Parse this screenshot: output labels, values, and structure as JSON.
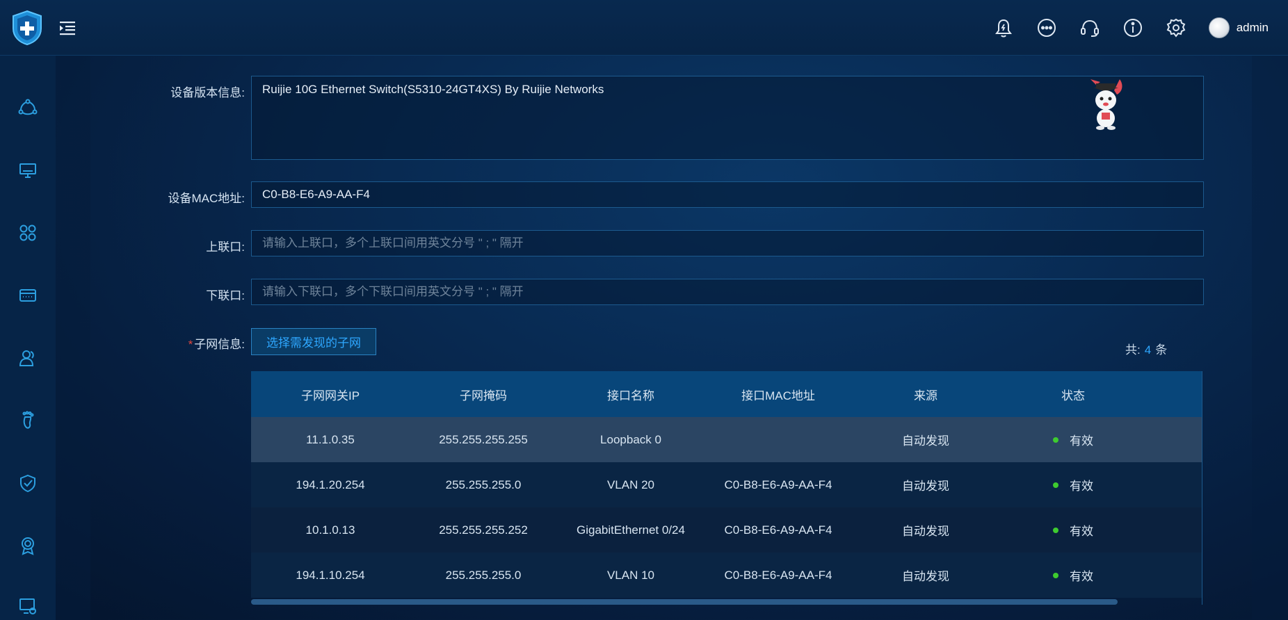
{
  "header": {
    "username": "admin",
    "icons": [
      "bell-icon",
      "more-icon",
      "headset-icon",
      "info-icon",
      "gear-icon"
    ]
  },
  "sidebar": {
    "items": [
      "topology-icon",
      "monitor-icon",
      "apps-icon",
      "device-icon",
      "user-icon",
      "footprint-icon",
      "shield-check-icon",
      "award-icon",
      "screen-settings-icon"
    ]
  },
  "form": {
    "version_label": "设备版本信息:",
    "version_value": "Ruijie 10G Ethernet Switch(S5310-24GT4XS) By Ruijie Networks",
    "mac_label": "设备MAC地址:",
    "mac_value": "C0-B8-E6-A9-AA-F4",
    "uplink_label": "上联口:",
    "uplink_placeholder": "请输入上联口，多个上联口间用英文分号 \" ; \" 隔开",
    "downlink_label": "下联口:",
    "downlink_placeholder": "请输入下联口，多个下联口间用英文分号 \" ; \" 隔开",
    "subnet_required": "*",
    "subnet_label": "子网信息:",
    "select_button": "选择需发现的子网"
  },
  "total": {
    "prefix": "共:",
    "count": "4",
    "suffix": "条"
  },
  "table": {
    "columns": [
      "子网网关IP",
      "子网掩码",
      "接口名称",
      "接口MAC地址",
      "来源",
      "状态"
    ],
    "rows": [
      {
        "ip": "11.1.0.35",
        "mask": "255.255.255.255",
        "iface": "Loopback 0",
        "mac": "",
        "source": "自动发现",
        "status": "有效"
      },
      {
        "ip": "194.1.20.254",
        "mask": "255.255.255.0",
        "iface": "VLAN 20",
        "mac": "C0-B8-E6-A9-AA-F4",
        "source": "自动发现",
        "status": "有效"
      },
      {
        "ip": "10.1.0.13",
        "mask": "255.255.255.252",
        "iface": "GigabitEthernet 0/24",
        "mac": "C0-B8-E6-A9-AA-F4",
        "source": "自动发现",
        "status": "有效"
      },
      {
        "ip": "194.1.10.254",
        "mask": "255.255.255.0",
        "iface": "VLAN 10",
        "mac": "C0-B8-E6-A9-AA-F4",
        "source": "自动发现",
        "status": "有效"
      }
    ]
  },
  "colors": {
    "accent": "#2ea7ff",
    "status_ok": "#3ecb2f",
    "required": "#e0463e"
  }
}
